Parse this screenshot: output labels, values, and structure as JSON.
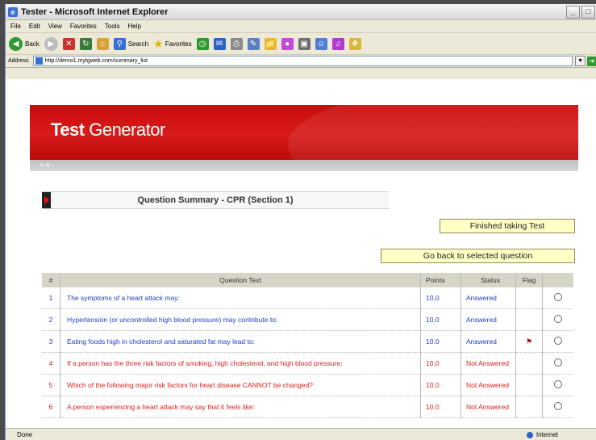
{
  "window": {
    "title": "Tester - Microsoft Internet Explorer",
    "buttons": [
      "_",
      "□"
    ]
  },
  "menu": [
    "File",
    "Edit",
    "View",
    "Favorites",
    "Tools",
    "Help"
  ],
  "toolbar": {
    "back": "Back",
    "search": "Search",
    "favorites": "Favorites"
  },
  "address": {
    "label": "Address",
    "url": "http://demo1.mytgweb.com/summary_list",
    "go": "Go"
  },
  "app": {
    "brand_bold": "Test",
    "brand_rest": " Generator",
    "stripe": "»»···",
    "section_title": "Question Summary - CPR (Section 1)",
    "finished_button": "Finished taking Test",
    "goback_button": "Go back to selected question"
  },
  "table": {
    "headers": [
      "#",
      "Question Text",
      "Points",
      "Status",
      "Flag"
    ],
    "rows": [
      {
        "num": "1",
        "text": "The symptoms of a heart attack may:",
        "points": "10.0",
        "status": "Answered",
        "answered": true,
        "flag": false
      },
      {
        "num": "2",
        "text": "Hypertension (or uncontrolled high blood pressure) may contribute to:",
        "points": "10.0",
        "status": "Answered",
        "answered": true,
        "flag": false
      },
      {
        "num": "3",
        "text": "Eating foods high in cholesterol and saturated fat may lead to:",
        "points": "10.0",
        "status": "Answered",
        "answered": true,
        "flag": true
      },
      {
        "num": "4",
        "text": "If a person has the three risk factors of smoking, high cholesterol, and high blood pressure:",
        "points": "10.0",
        "status": "Not Answered",
        "answered": false,
        "flag": false
      },
      {
        "num": "5",
        "text": "Which of the following major risk factors for heart disease CANNOT be changed?",
        "points": "10.0",
        "status": "Not Answered",
        "answered": false,
        "flag": false
      },
      {
        "num": "6",
        "text": "A person experiencing a heart attack may say that it feels like:",
        "points": "10.0",
        "status": "Not Answered",
        "answered": false,
        "flag": false
      }
    ]
  },
  "status": {
    "left": "Done",
    "zone": "Internet"
  },
  "colors": {
    "brand_red": "#c80c0c",
    "answered_blue": "#1f3ccc",
    "not_answered_red": "#e01d1d"
  }
}
